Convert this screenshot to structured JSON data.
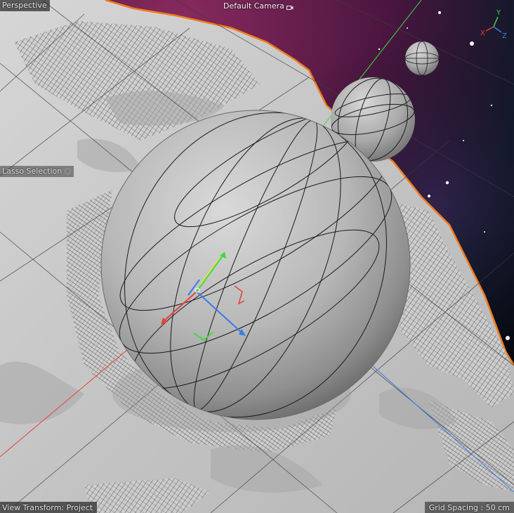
{
  "viewport": {
    "projection_label": "Perspective",
    "camera_label": "Default Camera",
    "camera_icon": "camera-icon",
    "tool_label": "Lasso Selection",
    "view_transform_label": "View Transform: Project",
    "grid_spacing_label": "Grid Spacing : 50 cm"
  },
  "axis_indicator": {
    "x_label": "X",
    "y_label": "Y",
    "z_label": "Z",
    "x_color": "#e8403a",
    "y_color": "#3ddc3d",
    "z_color": "#3a7bea"
  },
  "colors": {
    "selection_outline": "#f07a1a",
    "object_shading": "#c8c8c8",
    "sky_magenta": "#6e1a4a",
    "sky_dark": "#071018"
  }
}
